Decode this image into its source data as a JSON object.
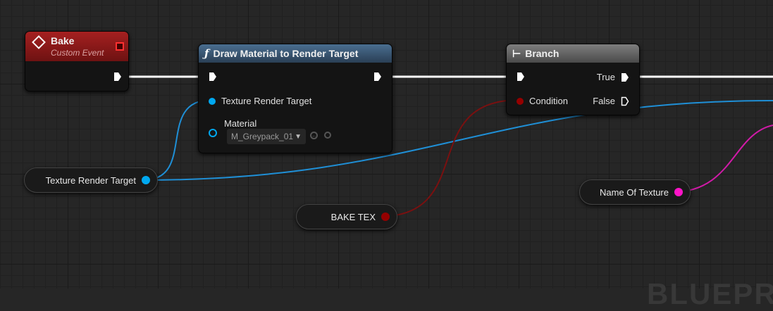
{
  "nodes": {
    "bake": {
      "title": "Bake",
      "subtitle": "Custom Event",
      "color": "#9b1c1c"
    },
    "draw": {
      "title": "Draw Material to Render Target",
      "pin_texture": "Texture Render Target",
      "pin_material": "Material",
      "material_value": "M_Greypack_01",
      "color": "#3c5a78"
    },
    "branch": {
      "title": "Branch",
      "pin_condition": "Condition",
      "pin_true": "True",
      "pin_false": "False",
      "color": "#6b6b6b"
    }
  },
  "variables": {
    "texture_render_target": {
      "label": "Texture Render Target",
      "color": "#00a8f0"
    },
    "bake_tex": {
      "label": "BAKE TEX",
      "color": "#950000"
    },
    "name_of_texture": {
      "label": "Name Of Texture",
      "color": "#ff14c8"
    }
  },
  "watermark": "BLUEPR",
  "colors": {
    "exec": "#ffffff",
    "object": "#00a8f0",
    "bool": "#950000",
    "string": "#ff14c8"
  }
}
